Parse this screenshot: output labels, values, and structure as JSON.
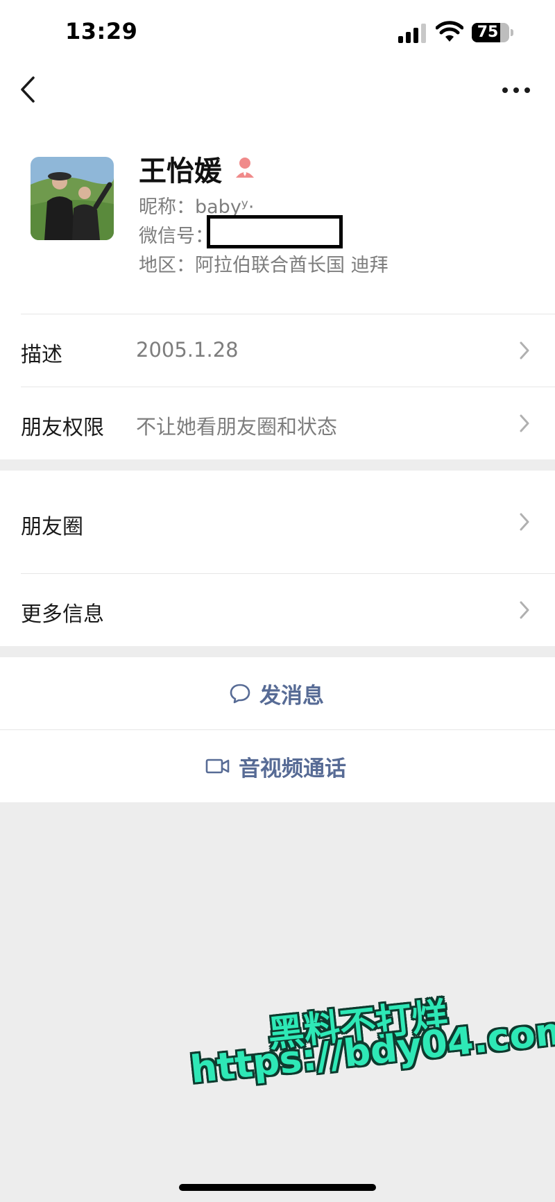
{
  "status_bar": {
    "time": "13:29",
    "battery_percent": "75",
    "battery_level": 0.75
  },
  "profile": {
    "name": "王怡媛",
    "nickname_line": "昵称：babyʸ·",
    "wechat_id_label": "微信号：",
    "region_line": "地区：阿拉伯联合酋长国 迪拜"
  },
  "rows": [
    {
      "label": "描述",
      "value": "2005.1.28"
    },
    {
      "label": "朋友权限",
      "value": "不让她看朋友圈和状态"
    },
    {
      "label": "朋友圈",
      "value": ""
    },
    {
      "label": "更多信息",
      "value": ""
    }
  ],
  "actions": {
    "message": "发消息",
    "call": "音视频通话"
  },
  "watermark": {
    "line1": "黑料不打烊",
    "line2": "https://bdy04.com"
  },
  "colors": {
    "link": "#576b95",
    "background": "#ededed",
    "watermark": "#2ee8b6"
  },
  "icons": [
    "back-icon",
    "more-icon",
    "star-friend-icon",
    "chevron-right-icon",
    "chat-bubble-icon",
    "video-call-icon"
  ]
}
